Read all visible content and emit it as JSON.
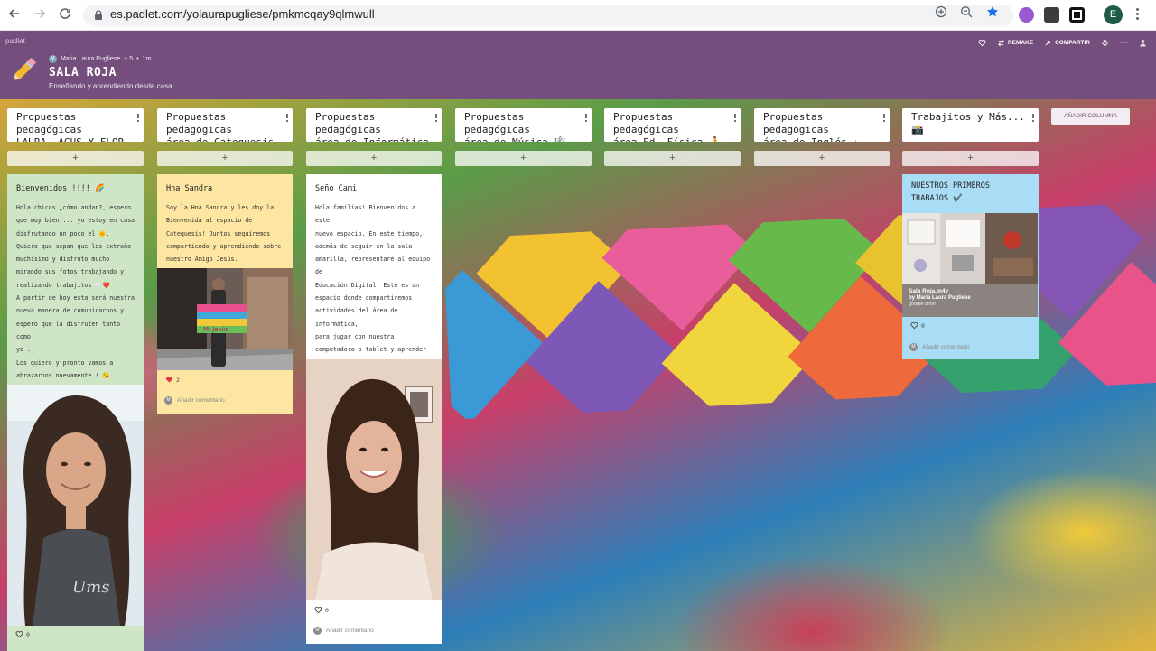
{
  "browser": {
    "url_host": "es.padlet.com",
    "url_path": "/yolaurapugliese/pmkmcqay9qlmwull",
    "profile_initial": "E"
  },
  "header": {
    "brand": "padlet",
    "author": "Maria Laura Pugliese",
    "collaborators": "+ 5",
    "time_ago": "1m",
    "title": "SALA ROJA",
    "subtitle": "Enseñando y aprendiendo desde casa",
    "remake_label": "REMAKE",
    "share_label": "COMPARTIR"
  },
  "board": {
    "add_column_label": "AÑADIR COLUMNA",
    "add_symbol": "+",
    "comment_placeholder": "Añadir comentario",
    "columns": [
      {
        "title": "Propuestas pedagógicas\nLAURA, AGUS Y FLOR"
      },
      {
        "title": "Propuestas pedagógicas\nárea de Catequesis ✝"
      },
      {
        "title": "Propuestas pedagógicas\nárea de Informática 💻"
      },
      {
        "title": "Propuestas pedagógicas\nárea de Música 🎼"
      },
      {
        "title": "Propuestas pedagógicas\nárea Ed. Física 🏃"
      },
      {
        "title": "Propuestas pedagógicas\nárea de Inglés ☆"
      },
      {
        "title": "Trabajitos y Más...\n📸"
      }
    ],
    "cards": [
      {
        "title": "Bienvenidos !!!! 🌈",
        "body": "Hola chicos ¿cómo andan?, espero\nque muy bien ... yo estoy en casa\ndisfrutando un poco el 🌞.\nQuiero que sepan que los extraño\nmuchísimo y disfruto mucho\nmirando sus fotos trabajando y\nrealizando trabajitos 🤍❤️\nA partir de hoy esta será nuestra\nnueva manera de comunicarnos y\nespero que la disfruten tanto como\nyo .\nLos quiero y pronto vamos a\nabrazarnos nuevamente ! 😘\nLAURA",
        "likes": "0",
        "color": "#cfe6c6"
      },
      {
        "title": "Hna Sandra",
        "body": "Soy la Hna Sandra y les doy la\nBienvenida al espacio de\nCatequesis! Juntos seguiremos\ncompartiendo y aprendiendo sobre\nnuestro Amigo Jesús.",
        "sign_text": "Mi Jesús",
        "likes": "2",
        "color": "#fde6a2"
      },
      {
        "title": "Seño Cami",
        "body": "Hola familias! Bienvenidos a este\nnuevo espacio. En este tiempo,\nademás de seguir en la sala\namarilla, representaré al equipo de\nEducación Digital. Este es un\nespacio donde compartiremos\nactividades del área de informática,\npara jugar con nuestra\ncomputadora o tablet y aprender\njuntos.\nLes mando un abrazo enorme\nLos quiero ❤️",
        "likes": "0",
        "color": "#ffffff"
      },
      {
        "title": "NUESTROS PRIMEROS\nTRABAJOS ✔️",
        "attachment_title": "Sala Roja.m4v",
        "attachment_author": "by Maria Laura Pugliese",
        "attachment_source": "google drive",
        "likes": "0",
        "color": "#a9dcf5"
      }
    ]
  },
  "colors": {
    "header_bg": "#744e7d",
    "like_heart": "#e0374e"
  }
}
